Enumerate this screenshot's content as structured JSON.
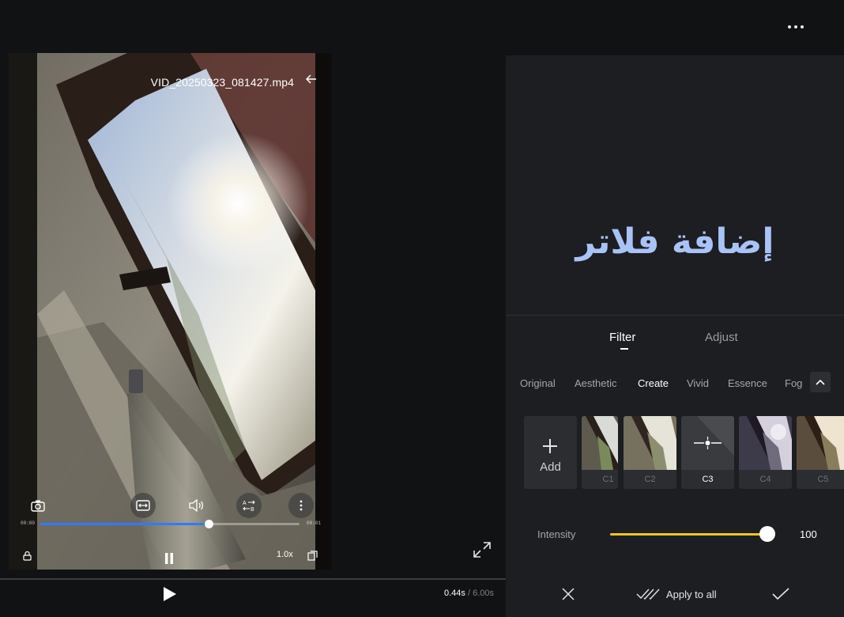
{
  "header": {
    "more_icon": "more-horizontal-icon"
  },
  "video": {
    "filename": "VID_20250323_081427.mp4",
    "back_icon": "arrow-left-icon",
    "current_timecode": "00:00",
    "end_timecode": "00:01",
    "playback_progress": 0.65,
    "speed": "1.0x",
    "controls": [
      "camera-icon",
      "fit-screen-icon",
      "volume-icon",
      "ab-compare-icon",
      "more-vertical-icon"
    ],
    "bottom_controls": [
      "lock-icon",
      "pause-icon",
      "aspect-ratio-icon"
    ]
  },
  "player": {
    "current_time": "0.44s",
    "separator": " / ",
    "total_time": "6.00s"
  },
  "panel": {
    "overlay_title": "إضافة فلاتر",
    "tabs": [
      {
        "label": "Filter",
        "active": true
      },
      {
        "label": "Adjust",
        "active": false
      }
    ],
    "categories": [
      {
        "label": "Original",
        "active": false
      },
      {
        "label": "Aesthetic",
        "active": false
      },
      {
        "label": "Create",
        "active": true
      },
      {
        "label": "Vivid",
        "active": false
      },
      {
        "label": "Essence",
        "active": false
      },
      {
        "label": "Fog",
        "active": false
      }
    ],
    "add_label": "Add",
    "filters": [
      {
        "name": "C1",
        "selected": false
      },
      {
        "name": "C2",
        "selected": false
      },
      {
        "name": "C3",
        "selected": true
      },
      {
        "name": "C4",
        "selected": false
      },
      {
        "name": "C5",
        "selected": false
      }
    ],
    "intensity_label": "Intensity",
    "intensity_value": "100",
    "intensity_level": 1.0,
    "apply_all_label": "Apply to all"
  },
  "colors": {
    "accent_blue": "#2f7cf6",
    "slider_yellow": "#f0c419",
    "overlay_text": "#a9c3f7",
    "panel_bg": "#1d1e21"
  }
}
